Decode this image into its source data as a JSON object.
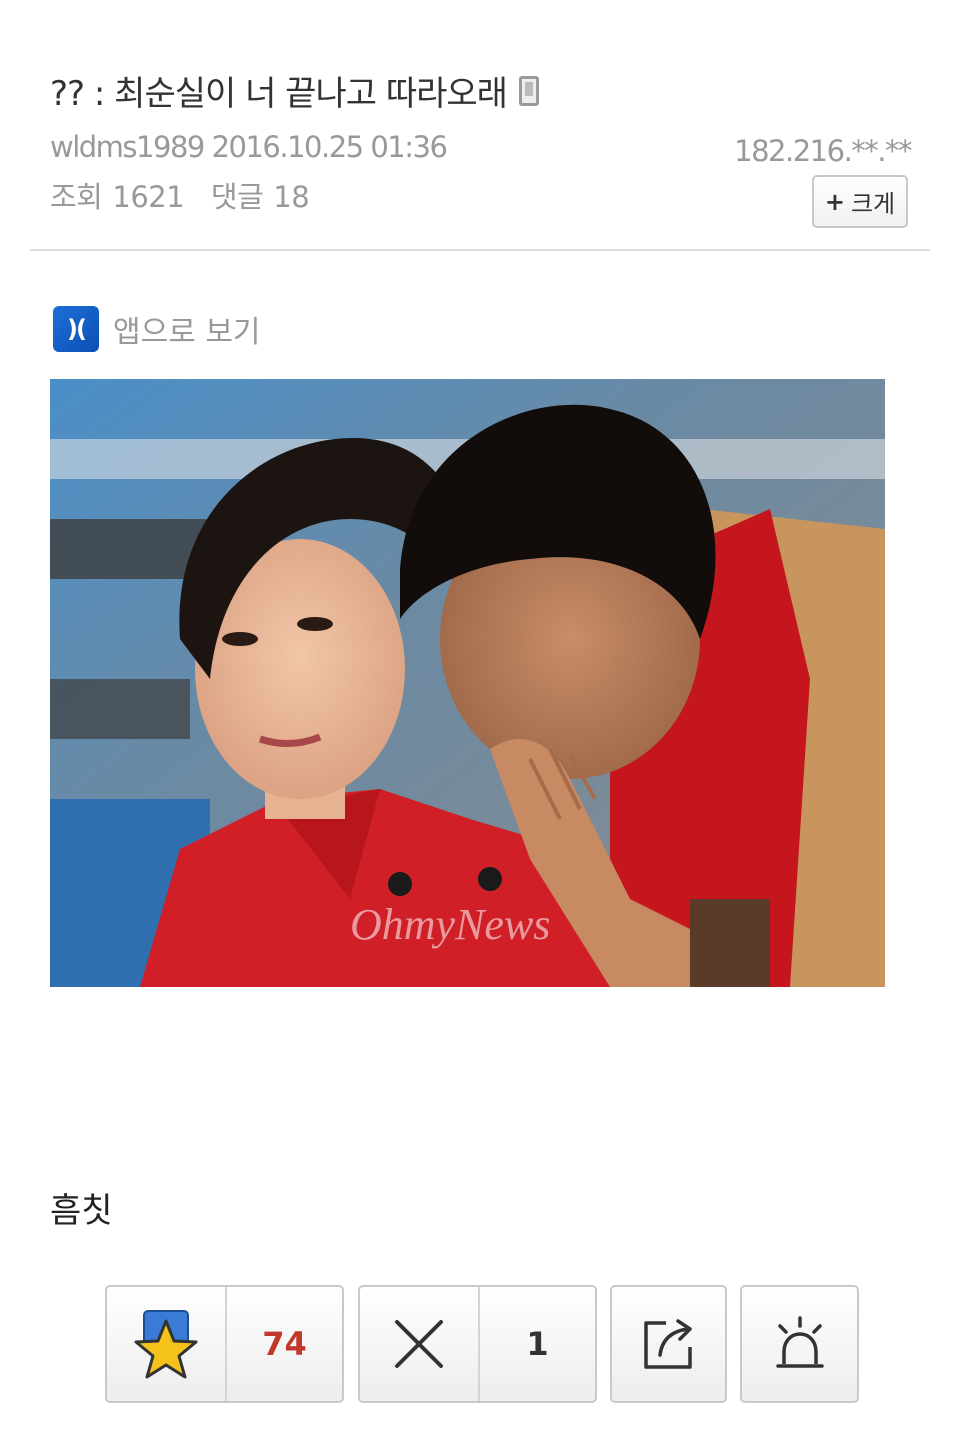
{
  "post": {
    "title": "?? : 최순실이 너 끝나고 따라오래",
    "author": "wldms1989",
    "datetime": "2016.10.25 01:36",
    "ip": "182.216.**.**",
    "views_label": "조회",
    "views": "1621",
    "comments_label": "댓글",
    "comments": "18",
    "body_text": "흠칫"
  },
  "toolbar": {
    "size_label": "크게",
    "size_prefix": "+"
  },
  "app_view": {
    "logo_text": ")(",
    "label": "앱으로 보기"
  },
  "image": {
    "watermark": "OhmyNews"
  },
  "actions": {
    "recommend_count": "74",
    "oppose_count": "1",
    "icons": [
      "star-icon",
      "x-icon",
      "share-icon",
      "siren-icon"
    ],
    "colors": {
      "recommend_count": "#c0392b",
      "star": "#f5c21b",
      "star_badge": "#3a7bd5"
    }
  }
}
